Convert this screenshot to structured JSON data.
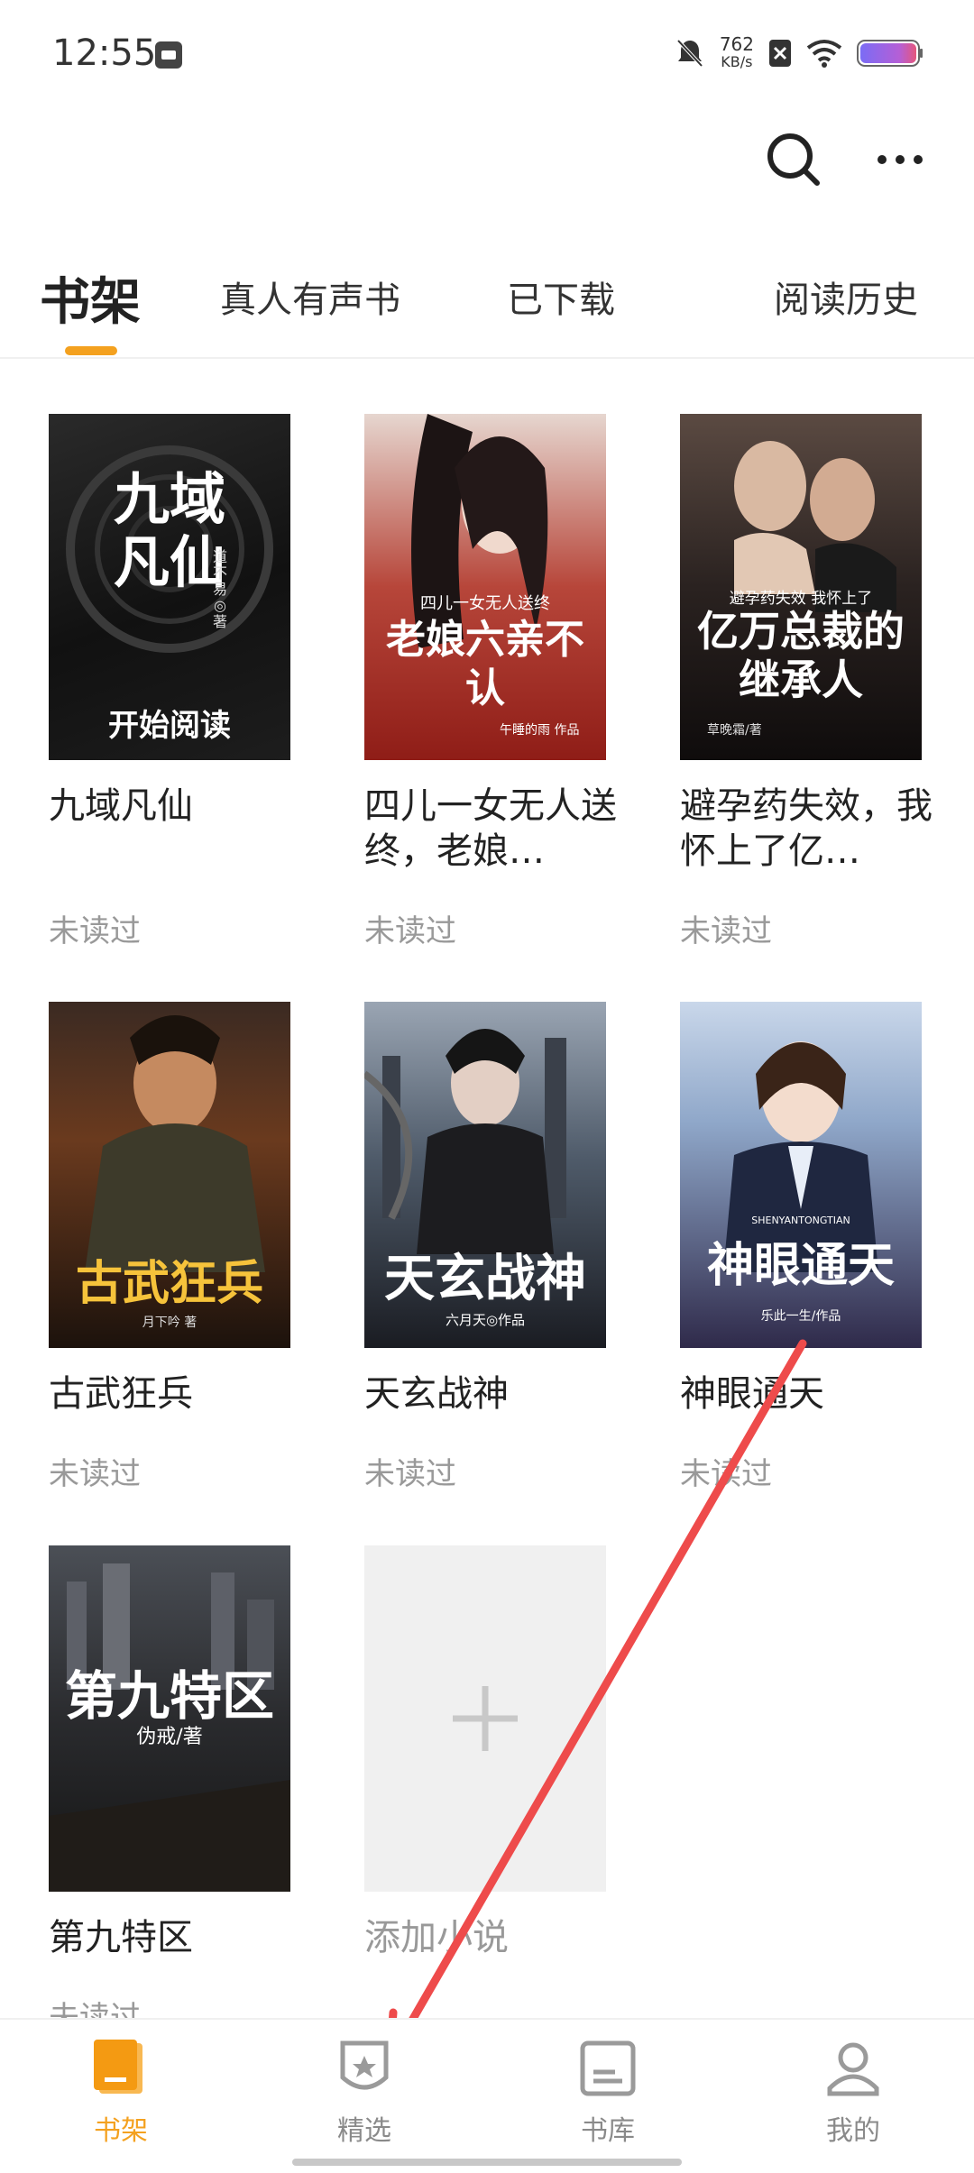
{
  "status_bar": {
    "time": "12:55",
    "net_speed_value": "762",
    "net_speed_unit": "KB/s"
  },
  "header": {
    "search_icon": "search-icon",
    "more_icon": "more-icon"
  },
  "tabs": [
    {
      "label": "书架",
      "active": true
    },
    {
      "label": "真人有声书",
      "active": false
    },
    {
      "label": "已下载",
      "active": false
    },
    {
      "label": "阅读历史",
      "active": false
    }
  ],
  "books": [
    {
      "title": "九域凡仙",
      "status": "未读过",
      "cover_text": "九域凡仙",
      "cover_author": "道不易◎著",
      "cover_button": "开始阅读"
    },
    {
      "title": "四儿一女无人送终，老娘…",
      "status": "未读过",
      "cover_text": "老娘六亲不认",
      "cover_tag": "四儿一女无人送终",
      "cover_author": "午睡的雨 作品"
    },
    {
      "title": "避孕药失效，我怀上了亿…",
      "status": "未读过",
      "cover_text": "亿万总裁的继承人",
      "cover_tag": "避孕药失效 我怀上了",
      "cover_author": "草晚霜/著"
    },
    {
      "title": "古武狂兵",
      "status": "未读过",
      "cover_text": "古武狂兵",
      "cover_author": "月下吟 著"
    },
    {
      "title": "天玄战神",
      "status": "未读过",
      "cover_text": "天玄战神",
      "cover_author": "六月天◎作品"
    },
    {
      "title": "神眼通天",
      "status": "未读过",
      "cover_text": "神眼通天",
      "cover_tag": "SHENYANTONGTIAN",
      "cover_author": "乐此一生/作品"
    },
    {
      "title": "第九特区",
      "status": "未读过",
      "cover_text": "第九特区",
      "cover_author": "伪戒/著"
    }
  ],
  "add_book": {
    "label": "添加小说",
    "icon": "plus-icon"
  },
  "bottom_nav": [
    {
      "label": "书架",
      "icon": "bookshelf-icon",
      "active": true
    },
    {
      "label": "精选",
      "icon": "featured-badge-icon",
      "active": false
    },
    {
      "label": "书库",
      "icon": "library-icon",
      "active": false
    },
    {
      "label": "我的",
      "icon": "profile-icon",
      "active": false
    }
  ],
  "colors": {
    "accent": "#f4a11f",
    "annotation_arrow": "#ee4b4b"
  }
}
